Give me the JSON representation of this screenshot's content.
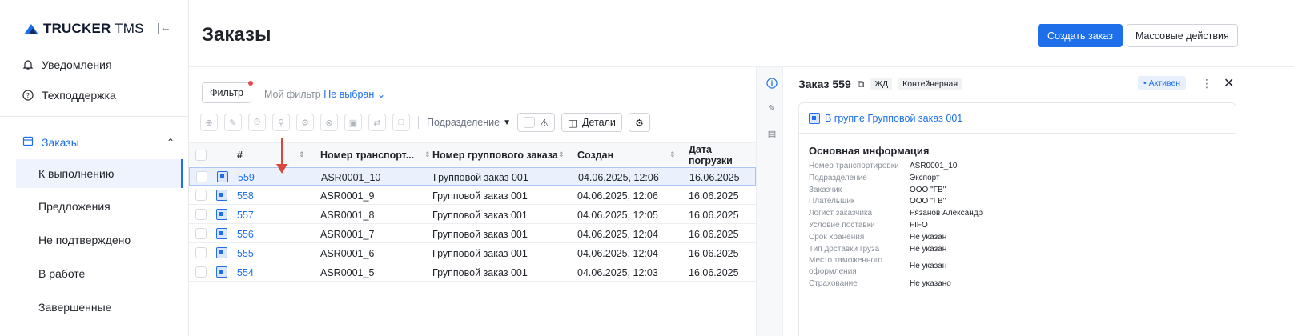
{
  "sidebar": {
    "brand_bold": "TRUCKER",
    "brand_light": " TMS",
    "top_items": [
      {
        "label": "Уведомления",
        "icon": "bell-icon"
      },
      {
        "label": "Техподдержка",
        "icon": "help-icon"
      }
    ],
    "section": {
      "label": "Заказы",
      "icon": "calendar-icon"
    },
    "sub_items": [
      "К выполнению",
      "Предложения",
      "Не подтверждено",
      "В работе",
      "Завершенные"
    ],
    "active_sub": "К выполнению"
  },
  "header": {
    "title": "Заказы",
    "create_label": "Создать заказ",
    "bulk_label": "Массовые действия"
  },
  "filters": {
    "filter_label": "Фильтр",
    "my_filter_label": "Мой фильтр",
    "my_filter_value": "Не выбран",
    "subdivision_label": "Подразделение",
    "details_label": "Детали"
  },
  "table": {
    "columns": [
      "#",
      "Номер транспорт...",
      "Номер группового заказа",
      "Создан",
      "Дата погрузки"
    ],
    "rows": [
      {
        "id": "559",
        "transport": "ASR0001_10",
        "group": "Групповой заказ 001",
        "created": "04.06.2025, 12:06",
        "load_date": "16.06.2025"
      },
      {
        "id": "558",
        "transport": "ASR0001_9",
        "group": "Групповой заказ 001",
        "created": "04.06.2025, 12:06",
        "load_date": "16.06.2025"
      },
      {
        "id": "557",
        "transport": "ASR0001_8",
        "group": "Групповой заказ 001",
        "created": "04.06.2025, 12:05",
        "load_date": "16.06.2025"
      },
      {
        "id": "556",
        "transport": "ASR0001_7",
        "group": "Групповой заказ 001",
        "created": "04.06.2025, 12:04",
        "load_date": "16.06.2025"
      },
      {
        "id": "555",
        "transport": "ASR0001_6",
        "group": "Групповой заказ 001",
        "created": "04.06.2025, 12:04",
        "load_date": "16.06.2025"
      },
      {
        "id": "554",
        "transport": "ASR0001_5",
        "group": "Групповой заказ 001",
        "created": "04.06.2025, 12:03",
        "load_date": "16.06.2025"
      }
    ]
  },
  "detail": {
    "title": "Заказ 559",
    "tag_rail": "ЖД",
    "tag_type": "Контейнерная",
    "status": "• Активен",
    "group_link": "В группе Групповой заказ 001",
    "info_title": "Основная информация",
    "info": [
      {
        "k": "Номер транспортировки",
        "v": "ASR0001_10"
      },
      {
        "k": "Подразделение",
        "v": "Экспорт"
      },
      {
        "k": "Заказчик",
        "v": "ООО \"ГВ\""
      },
      {
        "k": "Плательщик",
        "v": "ООО \"ГВ\""
      },
      {
        "k": "Логист заказчика",
        "v": "Рязанов Александр"
      },
      {
        "k": "Условие поставки",
        "v": "FIFO"
      },
      {
        "k": "Срок хранения",
        "v": "Не указан"
      },
      {
        "k": "Тип доставки груза",
        "v": "Не указан"
      },
      {
        "k": "Место таможенного оформления",
        "v": "Не указан"
      },
      {
        "k": "Страхование",
        "v": "Не указано"
      }
    ]
  },
  "colors": {
    "accent": "#1f6feb",
    "arrow": "#d9463a"
  }
}
